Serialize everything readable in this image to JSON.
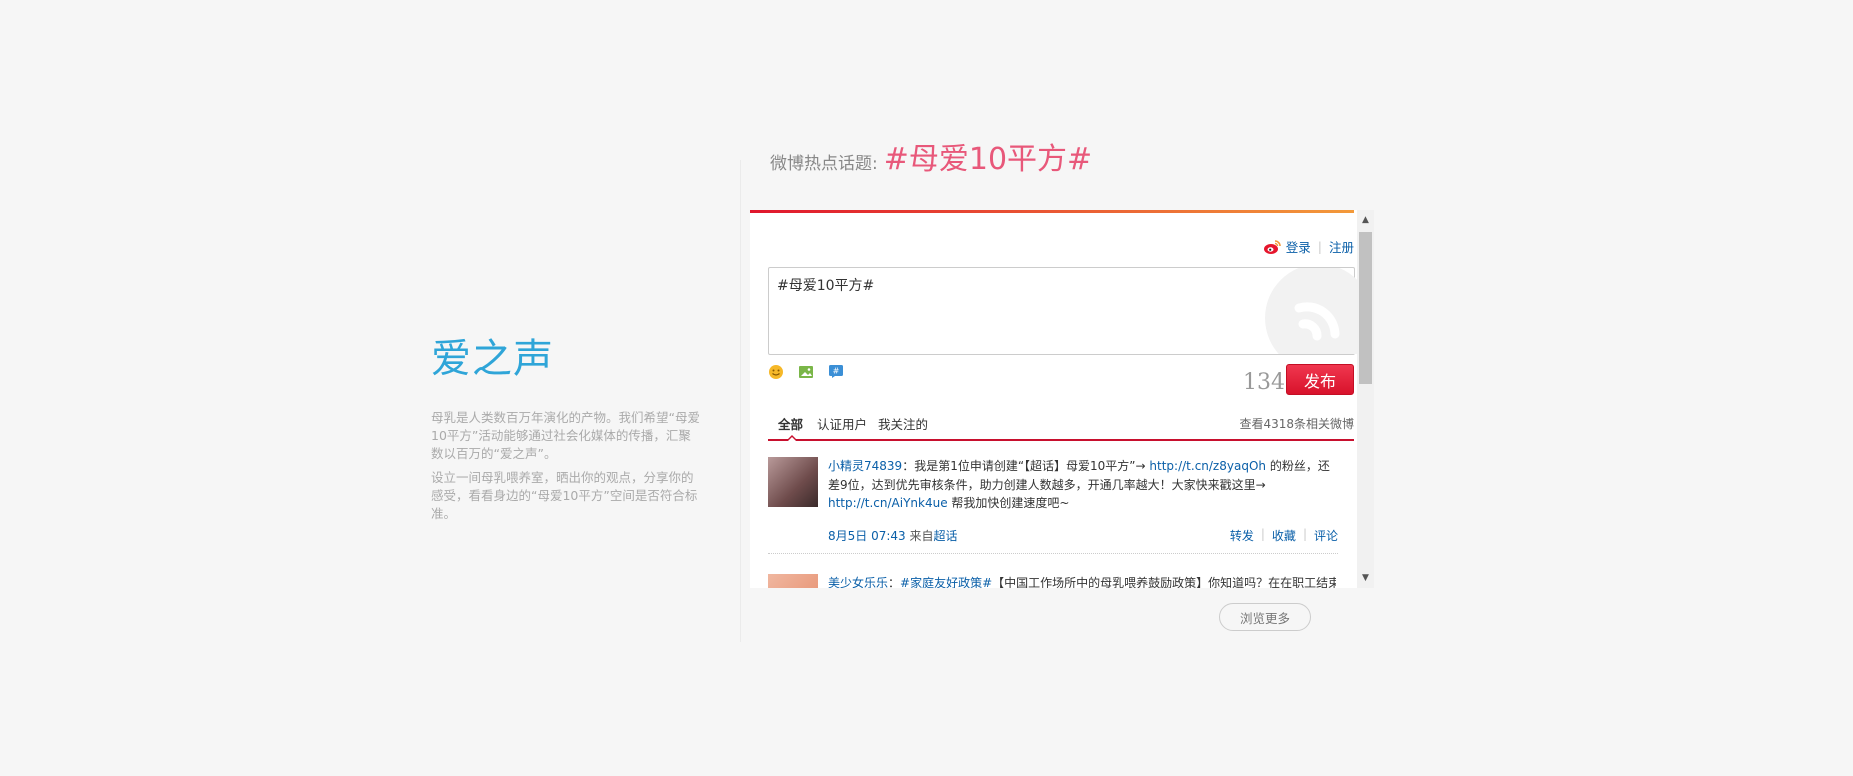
{
  "left": {
    "title": "爱之声",
    "paragraph1": "母乳是人类数百万年演化的产物。我们希望“母爱10平方”活动能够通过社会化媒体的传播，汇聚数以百万的“爱之声”。",
    "paragraph2": "设立一间母乳喂养室，晒出你的观点，分享你的感受，看看身边的“母爱10平方”空间是否符合标准。"
  },
  "topic": {
    "label": "微博热点话题:",
    "hashtag": "#母爱10平方#"
  },
  "widget": {
    "login": "登录",
    "register": "注册",
    "editor_value": "#母爱10平方#",
    "char_count": "134",
    "publish_label": "发布",
    "tools": [
      "emoticon-icon",
      "image-icon",
      "topic-icon"
    ],
    "tabs": [
      "全部",
      "认证用户",
      "我关注的"
    ],
    "view_all": "查看4318条相关微博",
    "posts": [
      {
        "author": "小精灵74839",
        "text_before_link1": "：我是第1位申请创建“【超话】母爱10平方”→ ",
        "link1": "http://t.cn/z8yaqOh",
        "text_after_link1": " 的粉丝，还差9位，达到优先审核条件，助力创建人数越多，开通几率越大！大家快来戳这里→ ",
        "link2": "http://t.cn/AiYnk4ue",
        "text_after_link2": " 帮我加快创建速度吧~",
        "time": "8月5日 07:43",
        "source_prefix": " 来自",
        "source": "超话",
        "actions": [
          "转发",
          "收藏",
          "评论"
        ]
      },
      {
        "author": "美少女乐乐",
        "hashtag": "#家庭友好政策#",
        "text": "【中国工作场所中的母乳喂养鼓励政策】你知道吗？在在职工结束"
      }
    ]
  },
  "more_label": "浏览更多",
  "colors": {
    "title_blue": "#2fa5d8",
    "hashtag_pink": "#e8587a",
    "weibo_red": "#d8122b",
    "link_blue": "#0a5fa8"
  }
}
